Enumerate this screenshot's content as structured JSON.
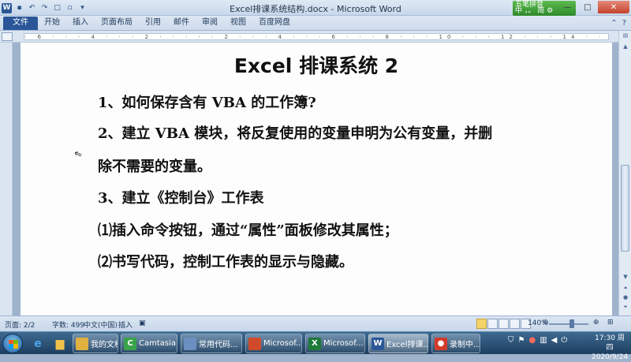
{
  "window": {
    "title": "Excel排课系统结构.docx - Microsoft Word",
    "ime_label": "五笔拼音",
    "ime_status": "中 ，。 简 ⚙"
  },
  "ribbon": {
    "tabs": [
      "文件",
      "开始",
      "插入",
      "页面布局",
      "引用",
      "邮件",
      "审阅",
      "视图",
      "百度网盘"
    ]
  },
  "document": {
    "title": "Excel 排课系统 2",
    "paragraphs": [
      "1、如何保存含有 VBA 的工作簿?",
      "2、建立 VBA 模块，将反复使用的变量申明为公有变量，并删",
      "除不需要的变量。",
      "3、建立《控制台》工作表",
      "⑴插入命令按钮，通过“属性”面板修改其属性；",
      "⑵书写代码，控制工作表的显示与隐藏。"
    ]
  },
  "statusbar": {
    "page": "页面: 2/2",
    "words": "字数: 499",
    "language": "中文(中国)",
    "mode": "插入",
    "zoom": "140%"
  },
  "taskbar": {
    "buttons": [
      {
        "label": "我的文档",
        "icon_color": "#e0b040",
        "icon": "folder-icon"
      },
      {
        "label": "Camtasia...",
        "icon_color": "#3aa34a",
        "icon": "camtasia-icon"
      },
      {
        "label": "常用代码...",
        "icon_color": "#6a8fc0",
        "icon": "notepad-icon"
      },
      {
        "label": "Microsof...",
        "icon_color": "#d04a2a",
        "icon": "office-icon"
      },
      {
        "label": "Microsof...",
        "icon_color": "#1f7a3a",
        "icon": "excel-icon"
      },
      {
        "label": "Excel排课...",
        "icon_color": "#2b5797",
        "icon": "word-icon"
      },
      {
        "label": "录制中...",
        "icon_color": "#d23a2a",
        "icon": "record-icon"
      }
    ],
    "time": "17:30 周四",
    "date": "2020/9/24"
  }
}
